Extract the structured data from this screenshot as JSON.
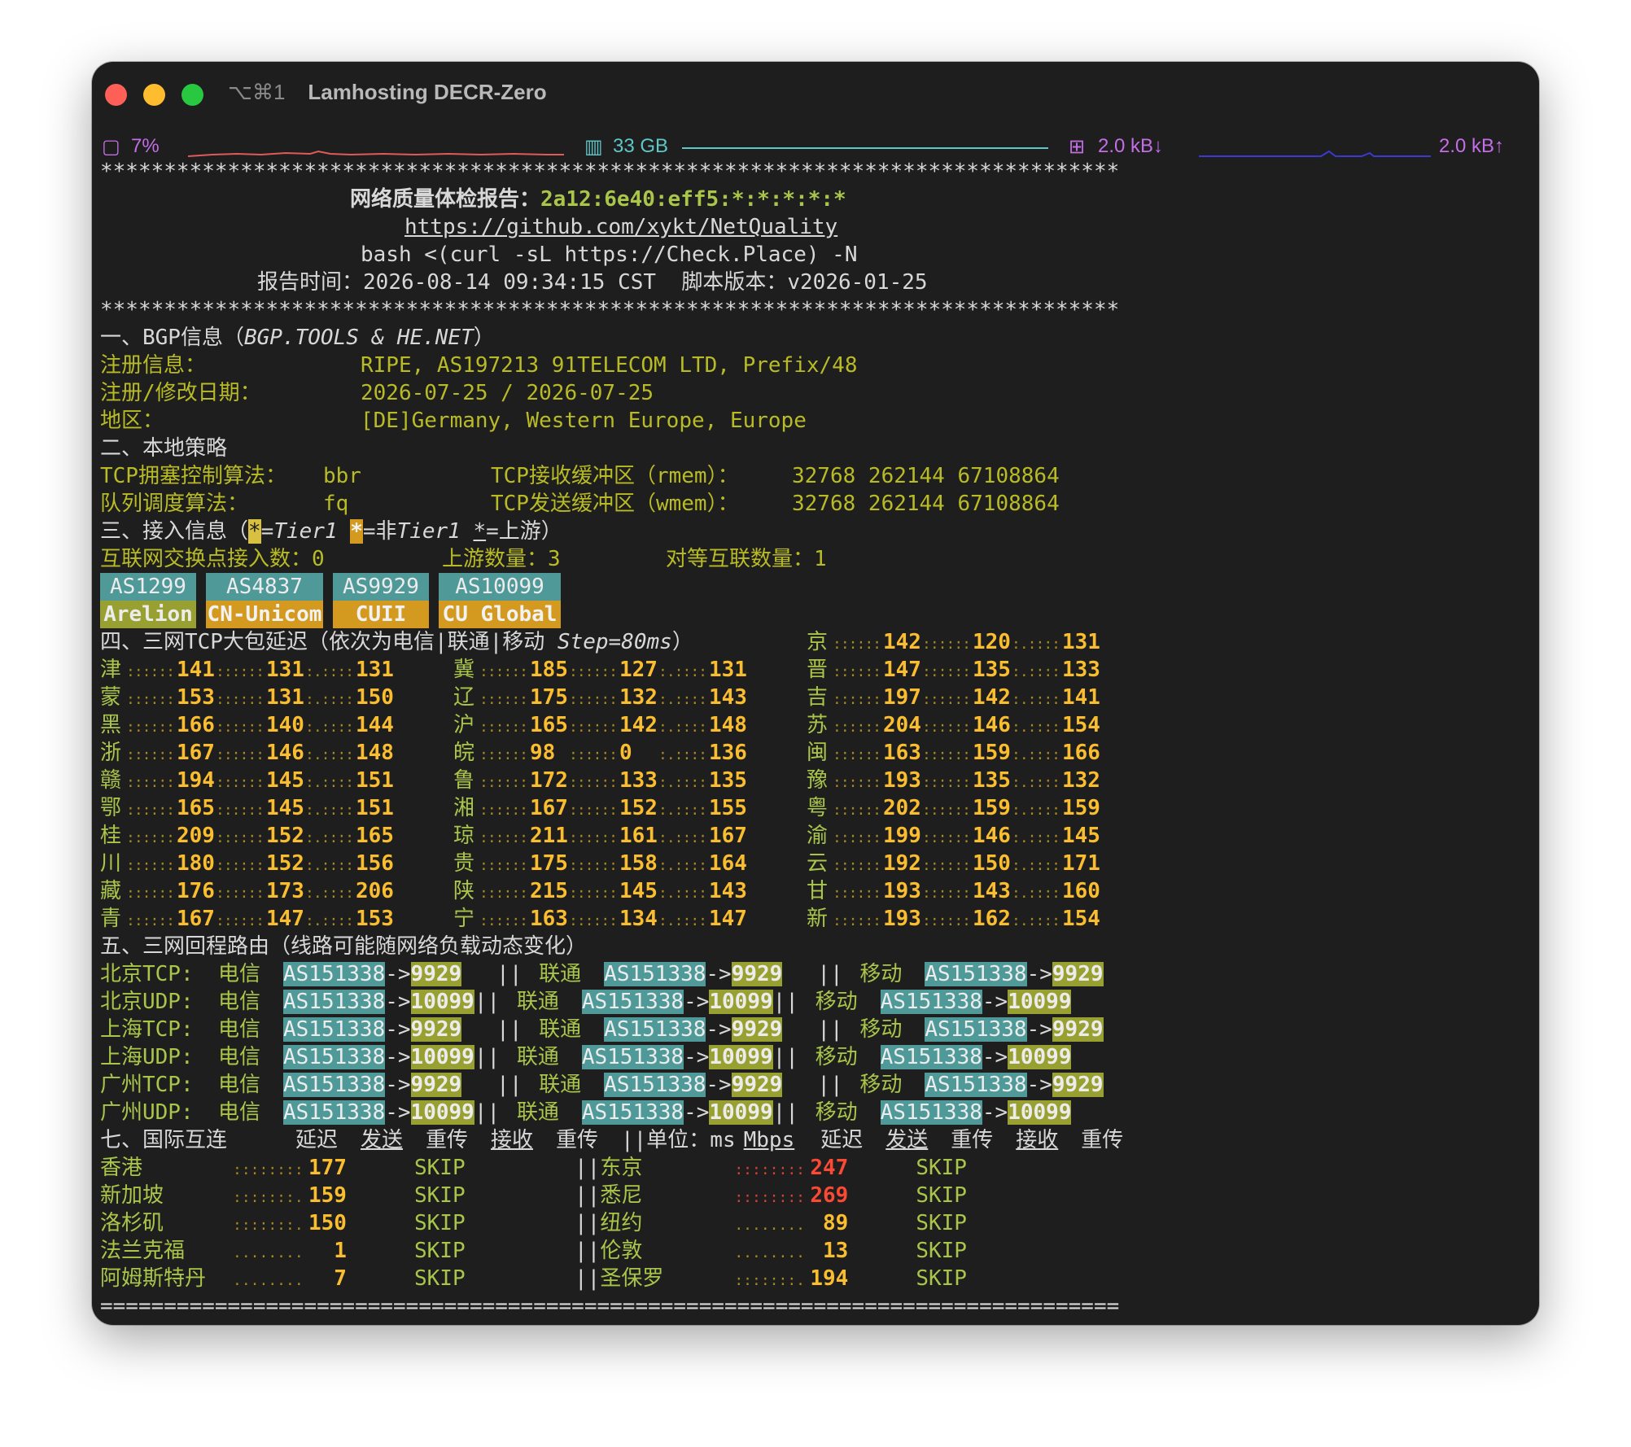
{
  "window": {
    "shortcut": "⌥⌘1",
    "title": "Lamhosting DECR-Zero"
  },
  "status": {
    "cpu_icon": "cpu-icon",
    "cpu_label": "7%",
    "mem_icon": "memory-icon",
    "mem_label": "33 GB",
    "net_icon": "network-icon",
    "net_down_label": "2.0 kB↓",
    "net_up_label": "2.0 kB↑",
    "colors": {
      "cpu": "#e05a5a",
      "mem": "#5fc7c7",
      "net": "#3a3ad0",
      "text": "#c46ee6"
    }
  },
  "report": {
    "stars": "********************************************************************************",
    "title_label": "网络质量体检报告：",
    "title_ip": "2a12:6e40:eff5:*:*:*:*:*",
    "repo_url": "https://github.com/xykt/NetQuality",
    "command": "bash <(curl -sL https://Check.Place) -N",
    "time_label": "报告时间：",
    "time_value": "2026-08-14 09:34:15 CST",
    "version_label": "脚本版本：",
    "version_value": "v2026-01-25",
    "footer": "================================================================================"
  },
  "bgp": {
    "heading": "一、BGP信息（",
    "heading_src": "BGP.TOOLS & HE.NET",
    "heading_end": "）",
    "reg_label": "注册信息：",
    "reg_value": "RIPE, AS197213 91TELECOM LTD, Prefix/48",
    "date_label": "注册/修改日期：",
    "date_value": "2026-07-25 / 2026-07-25",
    "region_label": "地区：",
    "region_value": "[DE]Germany, Western Europe, Europe"
  },
  "local": {
    "heading": "二、本地策略",
    "cc_label": "TCP拥塞控制算法：",
    "cc_value": "bbr",
    "rmem_label": "TCP接收缓冲区（rmem）：",
    "rmem_value": "32768 262144 67108864",
    "qd_label": "队列调度算法：",
    "qd_value": "fq",
    "wmem_label": "TCP发送缓冲区（wmem）：",
    "wmem_value": "32768 262144 67108864"
  },
  "access": {
    "heading_a": "三、接入信息（",
    "t1_mark": "*",
    "t1_label": "=Tier1 ",
    "nt1_mark": "*",
    "nt1_label": "=非",
    "nt1_label2": "Tier1 ",
    "up_mark": "*",
    "up_label": "=上游）",
    "ix_label": "互联网交换点接入数：",
    "ix_value": "0",
    "upstream_label": "上游数量：",
    "upstream_value": "3",
    "peer_label": "对等互联数量：",
    "peer_value": "1",
    "asns": [
      {
        "asn": "AS1299",
        "name": "Arelion"
      },
      {
        "asn": "AS4837",
        "name": "CN-Unicom"
      },
      {
        "asn": "AS9929",
        "name": "CUII"
      },
      {
        "asn": "AS10099",
        "name": "CU Global"
      }
    ]
  },
  "latency": {
    "heading": "四、三网TCP大包延迟（依次为电信|联通|移动 ",
    "step": "Step=80ms",
    "heading_end": "）",
    "first": {
      "region": "京",
      "values": [
        "142",
        "120",
        "131"
      ]
    },
    "rows": [
      [
        {
          "region": "津",
          "values": [
            "141",
            "131",
            "131"
          ]
        },
        {
          "region": "冀",
          "values": [
            "185",
            "127",
            "131"
          ]
        },
        {
          "region": "晋",
          "values": [
            "147",
            "135",
            "133"
          ]
        }
      ],
      [
        {
          "region": "蒙",
          "values": [
            "153",
            "131",
            "150"
          ]
        },
        {
          "region": "辽",
          "values": [
            "175",
            "132",
            "143"
          ]
        },
        {
          "region": "吉",
          "values": [
            "197",
            "142",
            "141"
          ]
        }
      ],
      [
        {
          "region": "黑",
          "values": [
            "166",
            "140",
            "144"
          ]
        },
        {
          "region": "沪",
          "values": [
            "165",
            "142",
            "148"
          ]
        },
        {
          "region": "苏",
          "values": [
            "204",
            "146",
            "154"
          ]
        }
      ],
      [
        {
          "region": "浙",
          "values": [
            "167",
            "146",
            "148"
          ]
        },
        {
          "region": "皖",
          "values": [
            "98",
            "0",
            "136"
          ]
        },
        {
          "region": "闽",
          "values": [
            "163",
            "159",
            "166"
          ]
        }
      ],
      [
        {
          "region": "赣",
          "values": [
            "194",
            "145",
            "151"
          ]
        },
        {
          "region": "鲁",
          "values": [
            "172",
            "133",
            "135"
          ]
        },
        {
          "region": "豫",
          "values": [
            "193",
            "135",
            "132"
          ]
        }
      ],
      [
        {
          "region": "鄂",
          "values": [
            "165",
            "145",
            "151"
          ]
        },
        {
          "region": "湘",
          "values": [
            "167",
            "152",
            "155"
          ]
        },
        {
          "region": "粤",
          "values": [
            "202",
            "159",
            "159"
          ]
        }
      ],
      [
        {
          "region": "桂",
          "values": [
            "209",
            "152",
            "165"
          ]
        },
        {
          "region": "琼",
          "values": [
            "211",
            "161",
            "167"
          ]
        },
        {
          "region": "渝",
          "values": [
            "199",
            "146",
            "145"
          ]
        }
      ],
      [
        {
          "region": "川",
          "values": [
            "180",
            "152",
            "156"
          ]
        },
        {
          "region": "贵",
          "values": [
            "175",
            "158",
            "164"
          ]
        },
        {
          "region": "云",
          "values": [
            "192",
            "150",
            "171"
          ]
        }
      ],
      [
        {
          "region": "藏",
          "values": [
            "176",
            "173",
            "206"
          ]
        },
        {
          "region": "陕",
          "values": [
            "215",
            "145",
            "143"
          ]
        },
        {
          "region": "甘",
          "values": [
            "193",
            "143",
            "160"
          ]
        }
      ],
      [
        {
          "region": "青",
          "values": [
            "167",
            "147",
            "153"
          ]
        },
        {
          "region": "宁",
          "values": [
            "163",
            "134",
            "147"
          ]
        },
        {
          "region": "新",
          "values": [
            "193",
            "162",
            "154"
          ]
        }
      ]
    ]
  },
  "routes": {
    "heading": "五、三网回程路由（线路可能随网络负载动态变化）",
    "carriers": [
      "电信",
      "联通",
      "移动"
    ],
    "sep": "||",
    "arrow": "->",
    "rows": [
      {
        "label": "北京TCP:",
        "src": "AS151338",
        "dst": "9929"
      },
      {
        "label": "北京UDP:",
        "src": "AS151338",
        "dst": "10099"
      },
      {
        "label": "上海TCP:",
        "src": "AS151338",
        "dst": "9929"
      },
      {
        "label": "上海UDP:",
        "src": "AS151338",
        "dst": "10099"
      },
      {
        "label": "广州TCP:",
        "src": "AS151338",
        "dst": "9929"
      },
      {
        "label": "广州UDP:",
        "src": "AS151338",
        "dst": "10099"
      }
    ]
  },
  "intl": {
    "heading": "七、国际互连",
    "cols": [
      "延迟",
      "发送",
      "重传",
      "接收",
      "重传"
    ],
    "unit_label": "||单位：ms",
    "unit_mbps": "Mbps",
    "skip": "SKIP",
    "sep": "||",
    "rows": [
      {
        "left": {
          "city": "香港",
          "dots": "::::::::",
          "latency": "177"
        },
        "right": {
          "city": "东京",
          "dots": "::::::::",
          "latency": "247",
          "red": true
        }
      },
      {
        "left": {
          "city": "新加坡",
          "dots": ":::::::.",
          "latency": "159"
        },
        "right": {
          "city": "悉尼",
          "dots": "::::::::",
          "latency": "269",
          "red": true
        }
      },
      {
        "left": {
          "city": "洛杉矶",
          "dots": ":::::::.",
          "latency": "150"
        },
        "right": {
          "city": "纽约",
          "dots": "........",
          "latency": " 89",
          "red": false
        }
      },
      {
        "left": {
          "city": "法兰克福",
          "dots": "........",
          "latency": "  1"
        },
        "right": {
          "city": "伦敦",
          "dots": "........",
          "latency": " 13",
          "red": false
        }
      },
      {
        "left": {
          "city": "阿姆斯特丹",
          "dots": "........",
          "latency": "  7"
        },
        "right": {
          "city": "圣保罗",
          "dots": ":::::::.",
          "latency": "194",
          "red": false
        }
      }
    ]
  }
}
